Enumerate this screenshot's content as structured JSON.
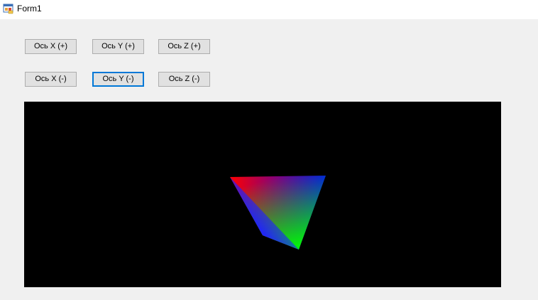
{
  "window": {
    "title": "Form1",
    "icon": "winforms-app-icon"
  },
  "buttons": {
    "x_plus": "Ось X (+)",
    "y_plus": "Ось Y (+)",
    "z_plus": "Ось Z (+)",
    "x_minus": "Ось X (-)",
    "y_minus": "Ось Y (-)",
    "z_minus": "Ось Z (-)"
  },
  "viewport": {
    "background": "#000000",
    "object": "gradient-tetrahedron",
    "vertex_colors": [
      "#ff0000",
      "#0000ff",
      "#00ff00",
      "#2020ff"
    ]
  },
  "colors": {
    "window_bg": "#f0f0f0",
    "titlebar_bg": "#ffffff",
    "button_bg": "#e1e1e1",
    "button_border": "#adadad",
    "focus_border": "#0078d7"
  }
}
